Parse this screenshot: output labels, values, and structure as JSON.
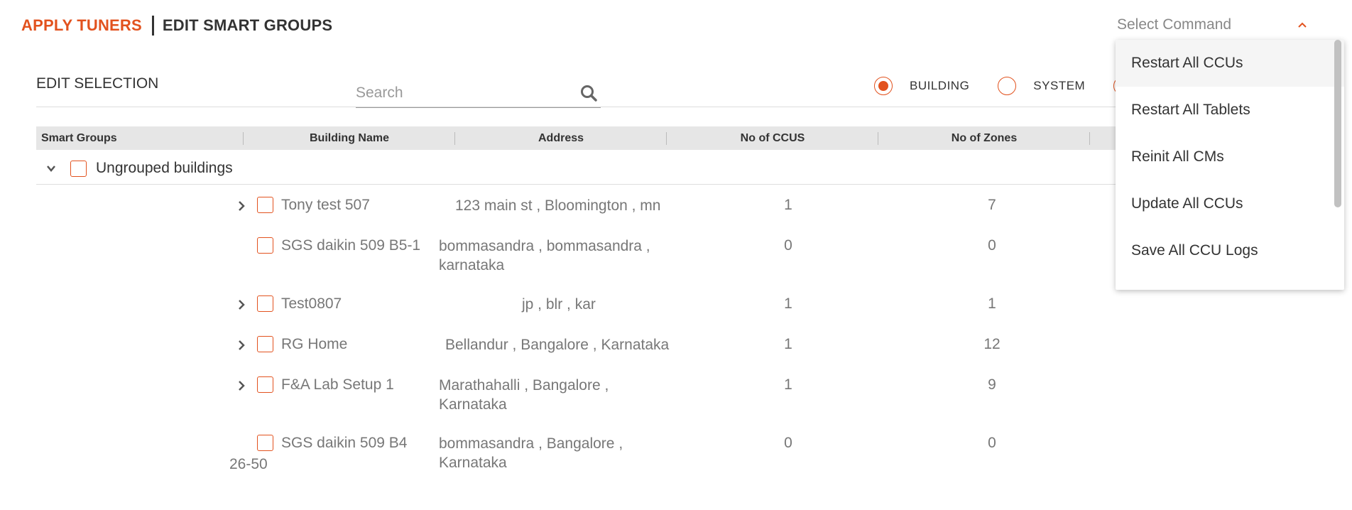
{
  "header": {
    "tab_apply": "APPLY TUNERS",
    "tab_edit": "EDIT SMART GROUPS"
  },
  "command": {
    "label": "Select Command",
    "options": [
      "Restart All CCUs",
      "Restart All Tablets",
      "Reinit All CMs",
      "Update All CCUs",
      "Save All CCU Logs"
    ]
  },
  "selection": {
    "title": "EDIT SELECTION",
    "search_placeholder": "Search",
    "radios": [
      {
        "label": "BUILDING",
        "selected": true
      },
      {
        "label": "SYSTEM",
        "selected": false
      }
    ]
  },
  "table": {
    "columns": [
      "Smart Groups",
      "Building Name",
      "Address",
      "No of CCUS",
      "No of Zones"
    ],
    "group": "Ungrouped buildings",
    "rows": [
      {
        "name": "Tony test 507",
        "address": "123 main st , Bloomington , mn",
        "ccus": "1",
        "zones": "7",
        "expandable": true
      },
      {
        "name": "SGS daikin 509 B5-1",
        "address_line1": "bommasandra , bommasandra ,",
        "address_line2": "karnataka",
        "ccus": "0",
        "zones": "0",
        "expandable": false
      },
      {
        "name": "Test0807",
        "address": "jp , blr , kar",
        "ccus": "1",
        "zones": "1",
        "expandable": true
      },
      {
        "name": "RG Home",
        "address": "Bellandur , Bangalore , Karnataka",
        "ccus": "1",
        "zones": "12",
        "expandable": true
      },
      {
        "name": "F&A Lab Setup 1",
        "address_line1": "Marathahalli , Bangalore ,",
        "address_line2": "Karnataka",
        "ccus": "1",
        "zones": "9",
        "expandable": true
      },
      {
        "name_line1": "SGS daikin 509 B4",
        "name_line2": "26-50",
        "address_line1": "bommasandra , Bangalore ,",
        "address_line2": "Karnataka",
        "ccus": "0",
        "zones": "0",
        "expandable": false
      }
    ]
  },
  "colors": {
    "accent": "#e2521e",
    "text": "#333333",
    "muted": "#777777",
    "header_bg": "#e6e6e6"
  }
}
